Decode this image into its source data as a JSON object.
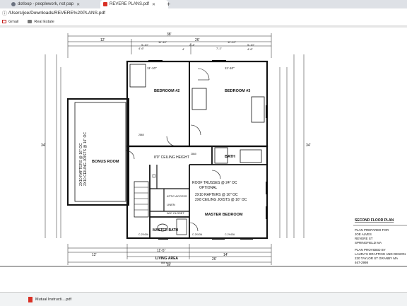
{
  "tabs": [
    {
      "label": "dotloop - peoplework, not pap",
      "active": false
    },
    {
      "label": "REVERE PLANS.pdf",
      "active": true
    }
  ],
  "address": {
    "url": "/Users/joe/Downloads/REVERE%20PLANS.pdf"
  },
  "bookmarks": [
    {
      "label": "Gmail",
      "icon": "gmail-icon"
    },
    {
      "label": "Real Estate",
      "icon": "folder-icon"
    }
  ],
  "plan": {
    "dims_top": {
      "overall": "38'",
      "inner": "26'",
      "left": "12'",
      "d1": "5'-10\"",
      "d2": "11'-10\"",
      "d3": "2'-4\"",
      "d4": "11'-10\"",
      "d5": "5'-10\"",
      "d6": "4'",
      "d7": "7'-1\"",
      "d8": "4'-6\""
    },
    "bedroom2": {
      "name": "BEDROOM #2",
      "dim": "11'-10\""
    },
    "bedroom3": {
      "name": "BEDROOM #3",
      "dim": "11'-10\""
    },
    "bonus": {
      "name": "BONUS ROOM",
      "rafters": "2X10 RAFTERS @ 16\" OC",
      "joists": "2X10 CEILING JOISTS @ 16\" OC"
    },
    "ceiling": "8'0\" CEILING HEIGHT",
    "bath": "BATH",
    "trusses": "ROOF TRUSSES @ 24\" OC",
    "optional": "OPTIONAL",
    "rafters2": "2X10 RAFTERS @ 16\" OC",
    "joists2": "2X8 CEILING JOISTS @ 16\" OC",
    "master": "MASTER BEDROOM",
    "mbath": "MASTER BATH",
    "linen": "LINEN",
    "closet": "W/C CLOSET",
    "attic": "ATTIC ACCESS",
    "living_area": "LIVING AREA",
    "area_value": "866 sq ft",
    "dims_bottom": {
      "overall": "38'",
      "inner": "26'",
      "left": "12'",
      "a": "14'",
      "b": "11'-5\""
    },
    "dim_left": "34'",
    "dim_right": "34'",
    "window_code": "C-2X43A",
    "door_code": "2860"
  },
  "title_block": {
    "plan_name": "SECOND FLOOR PLAN",
    "prepared_for": "PLAN PREPARED FOR",
    "client": "JOE ALVES",
    "street": "REVERE ST",
    "city": "SPRINGFIELD MA",
    "provided_by": "PLAN PROVIDED BY",
    "company": "LAURA'S DRAFTING AND DESIGN",
    "address": "220 TAYLOR ST GRANBY MA",
    "phone": "467-2998"
  },
  "download": {
    "file": "Mutual Instructi....pdf"
  }
}
